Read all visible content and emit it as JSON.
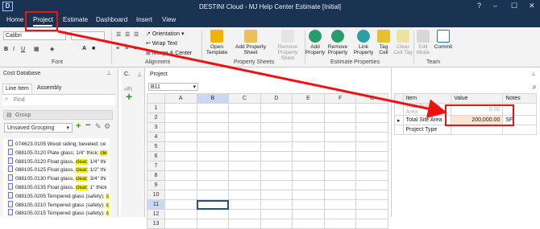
{
  "window": {
    "title": "DESTINI Cloud - MJ Help Center Estimate [Initial]",
    "logo_text": "D",
    "controls": [
      "?",
      "–",
      "☐",
      "✕"
    ]
  },
  "menu": {
    "tabs": [
      "Home",
      "Project",
      "Estimate",
      "Dashboard",
      "Insert",
      "View"
    ],
    "active": "Project"
  },
  "ribbon": {
    "font_name": "Calibri",
    "font_group": "Font",
    "alignment_group": "Alignment",
    "orientation": "Orientation",
    "wrap_text": "Wrap Text",
    "merge_center": "Merge & Center",
    "property_sheets_group": "Property Sheets",
    "estimate_properties_group": "Estimate Properties",
    "team_group": "Team",
    "buttons": {
      "open_template": [
        "Open",
        "Template"
      ],
      "add_property_sheet": [
        "Add Property",
        "Sheet"
      ],
      "remove_property_sheet": [
        "Remove",
        "Property Sheet"
      ],
      "add_property": [
        "Add",
        "Property"
      ],
      "remove_property": [
        "Remove",
        "Property"
      ],
      "link_property": [
        "Link",
        "Property"
      ],
      "tag_cell": [
        "Tag",
        "Cell"
      ],
      "clear_cell_tag": [
        "Clear",
        "Cell Tag"
      ],
      "edit_mode": [
        "Edit",
        "Mode"
      ],
      "commit": [
        "Commit",
        ""
      ]
    }
  },
  "cost_database": {
    "title": "Cost Database",
    "tabs": [
      "Line Item",
      "Assembly"
    ],
    "find_placeholder": "Find",
    "group_label": "Group",
    "grouping_value": "Unsaved Grouping",
    "items": [
      {
        "code": "074623.0105",
        "pre": "Wood siding; beveled; ce",
        "hl": "",
        "post": ""
      },
      {
        "code": "088105.0120",
        "pre": "Plate glass; 1/4\" thick; ",
        "hl": "cle",
        "post": ""
      },
      {
        "code": "088105.0120",
        "pre": "Float glass, ",
        "hl": "clear",
        "post": "; 1/4\" thi"
      },
      {
        "code": "088105.0125",
        "pre": "Float glass, ",
        "hl": "clear",
        "post": "; 1/2\" thi"
      },
      {
        "code": "088105.0130",
        "pre": "Float glass, ",
        "hl": "clear",
        "post": "; 3/4\" thi"
      },
      {
        "code": "088105.0135",
        "pre": "Float glass, ",
        "hl": "clear",
        "post": "; 1\" thick"
      },
      {
        "code": "088105.0205",
        "pre": "Tempered glass (safety); ",
        "hl": "c",
        "post": ""
      },
      {
        "code": "088105.0210",
        "pre": "Tempered glass (safety); ",
        "hl": "c",
        "post": ""
      },
      {
        "code": "088105.0215",
        "pre": "Tempered glass (safety); ",
        "hl": "c",
        "post": ""
      }
    ]
  },
  "mid_panel": {
    "title": "C.",
    "find_placeholder": "Fi"
  },
  "project": {
    "title": "Project",
    "cell_ref": "B11",
    "columns": [
      "A",
      "B",
      "C",
      "D",
      "E",
      "F",
      "G"
    ],
    "rows": [
      "1",
      "2",
      "3",
      "4",
      "5",
      "6",
      "7",
      "8",
      "9",
      "10",
      "11",
      "12",
      "13"
    ],
    "selected_col": "B",
    "selected_row": "11"
  },
  "properties": {
    "headers": [
      "Item",
      "Value",
      "Notes"
    ],
    "rows": [
      {
        "item": "Total Building Area",
        "value": "0.00",
        "notes": "",
        "muted": true
      },
      {
        "item": "Total Site Area",
        "value": "200,000.00",
        "notes": "SF",
        "muted": false
      },
      {
        "item": "Project Type",
        "value": "",
        "notes": "",
        "muted": false
      }
    ]
  },
  "colors": {
    "titlebar": "#1a3352",
    "annotation_red": "#e11111",
    "highlight": "#f6f200",
    "selected_value_bg": "#fce4cf"
  }
}
